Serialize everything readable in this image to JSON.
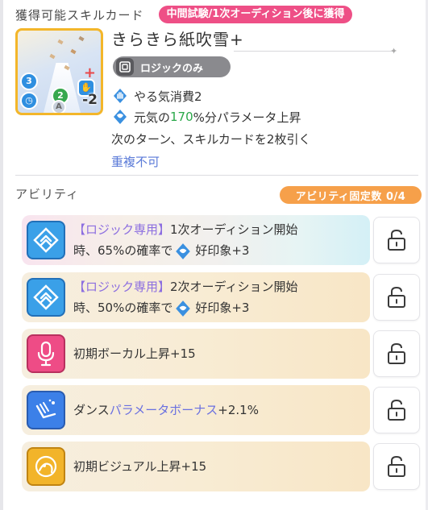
{
  "header": {
    "title": "獲得可能スキルカード",
    "acquisition_badge": "中間試験/1次オーディション後に獲得"
  },
  "card": {
    "name": "きらきら紙吹雪+",
    "plan_label": "ロジックのみ",
    "thumb_badges": [
      "3",
      "2",
      "A"
    ],
    "thumb_cost": "-2",
    "effects": [
      {
        "icon": "hand-icon",
        "text": "やる気消費2"
      },
      {
        "icon": "genki-icon",
        "prefix": "元気の",
        "value": "170",
        "suffix": "%分パラメータ上昇"
      }
    ],
    "extra_effect": "次のターン、スキルカードを2枚引く",
    "no_duplicate": "重複不可"
  },
  "abilities_section": {
    "title": "アビリティ",
    "fixed_count": "アビリティ固定数 0/4"
  },
  "abilities": [
    {
      "icon": "audition-chevron-icon",
      "tag": "【ロジック専用】",
      "line1": "1次オーディション開始",
      "line2_prefix": "時、65%の確率で",
      "line2_suffix": "好印象+3"
    },
    {
      "icon": "audition-chevron-icon",
      "tag": "【ロジック専用】",
      "line1": "2次オーディション開始",
      "line2_prefix": "時、50%の確率で",
      "line2_suffix": "好印象+3"
    },
    {
      "icon": "microphone-icon",
      "text": "初期ボーカル上昇+15"
    },
    {
      "icon": "dance-icon",
      "prefix": "ダンス",
      "highlight": "パラメータボーナス",
      "suffix": "+2.1%"
    },
    {
      "icon": "visual-icon",
      "text": "初期ビジュアル上昇+15"
    }
  ],
  "colors": {
    "acquisition_badge": "#ee4f86",
    "fixed_badge": "#f6a04a",
    "genki_value": "#2aa84a",
    "tag": "#8c6ee0",
    "no_duplicate": "#5a7ad8"
  }
}
